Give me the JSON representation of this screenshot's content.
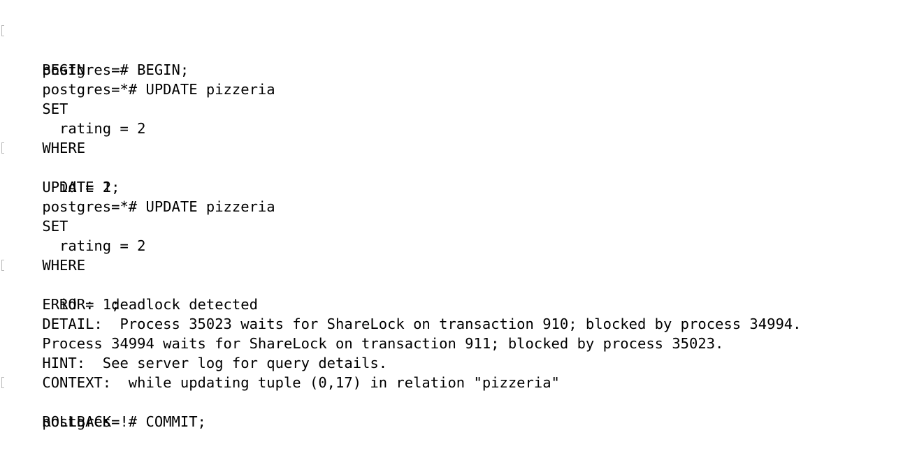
{
  "terminal": {
    "lines": [
      "postgres=# BEGIN;",
      "BEGIN",
      "postgres=*# UPDATE pizzeria",
      "SET",
      "  rating = 2",
      "WHERE",
      "  id = 2;",
      "UPDATE 1",
      "postgres=*# UPDATE pizzeria",
      "SET",
      "  rating = 2",
      "WHERE",
      "  id = 1;",
      "ERROR:  deadlock detected",
      "DETAIL:  Process 35023 waits for ShareLock on transaction 910; blocked by process 34994.",
      "Process 34994 waits for ShareLock on transaction 911; blocked by process 35023.",
      "HINT:  See server log for query details.",
      "CONTEXT:  while updating tuple (0,17) in relation \"pizzeria\"",
      "postgres=!# COMMIT;",
      "ROLLBACK"
    ]
  }
}
